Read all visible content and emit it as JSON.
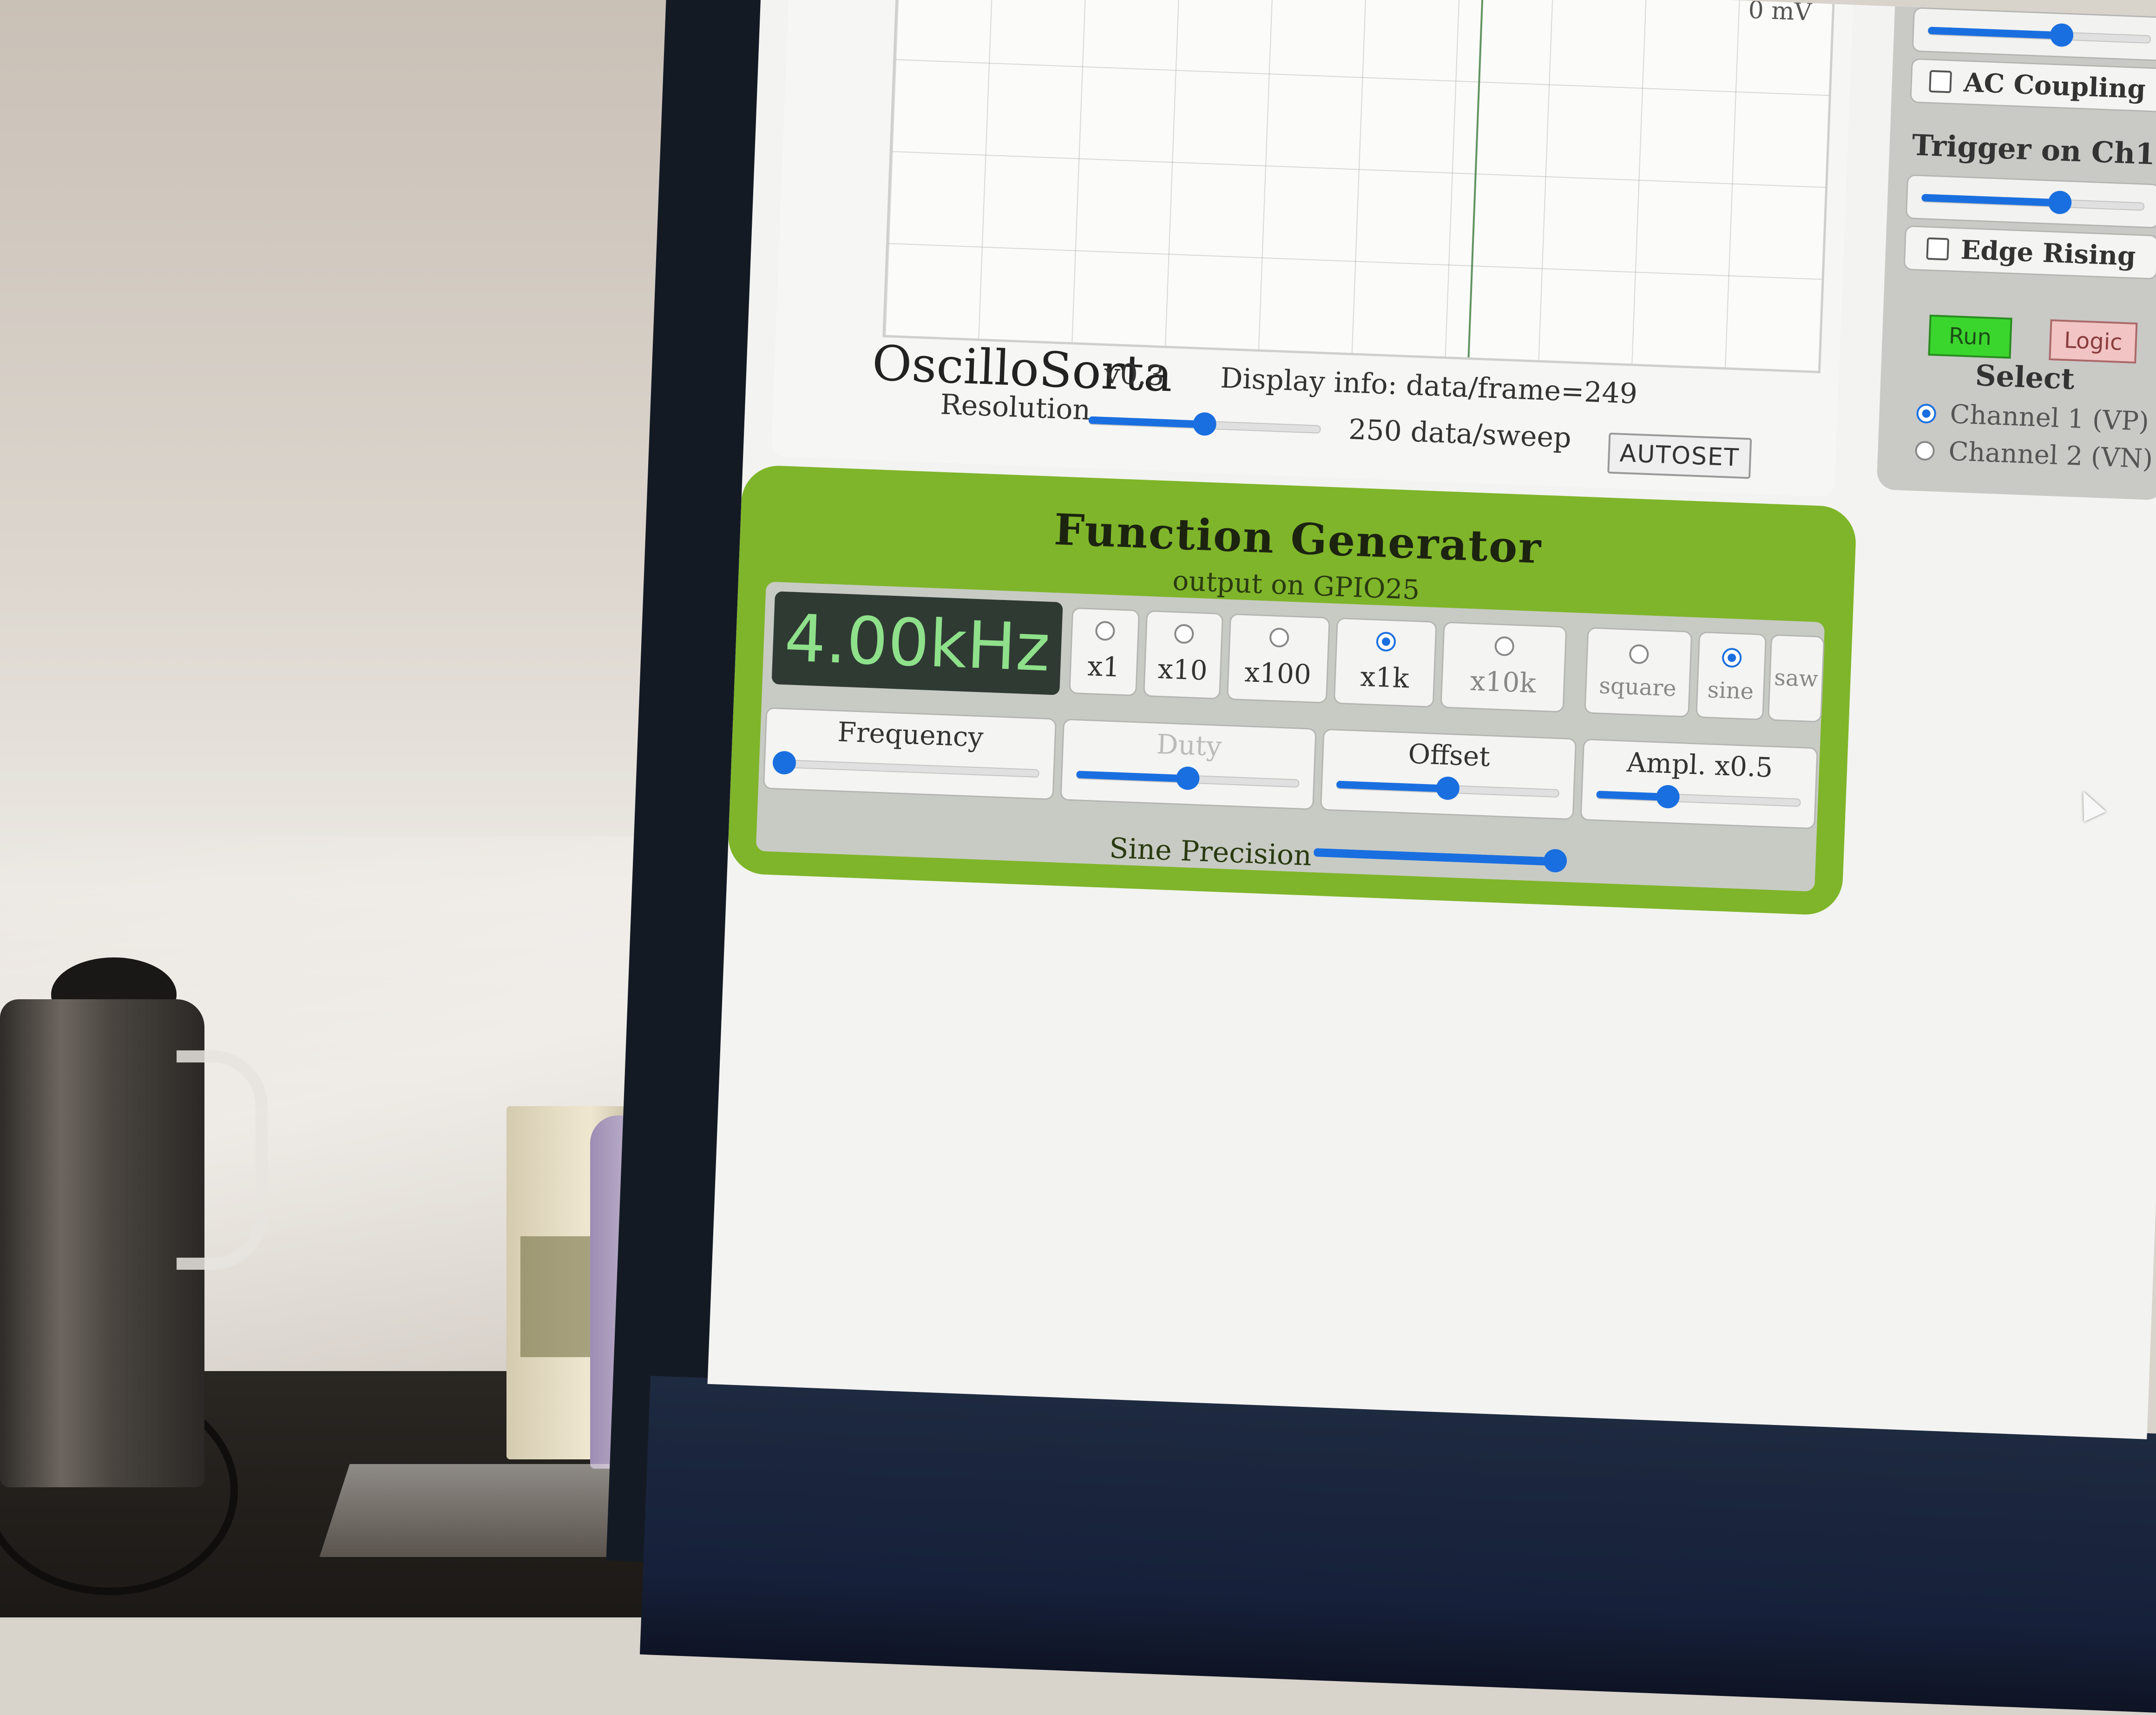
{
  "scope": {
    "plot_top_label": "0 mV",
    "app_title": "OscilloSorta",
    "app_version": "v0.3",
    "display_info": "Display info: data/frame=249",
    "resolution_label": "Resolution",
    "resolution_value": "250 data/sweep",
    "resolution_level": 0.5,
    "autoset_label": "AUTOSET"
  },
  "side": {
    "top_slider_level": 0.6,
    "ac_coupling_label": "AC Coupling",
    "trigger_heading": "Trigger on Ch1",
    "trigger_level": 0.62,
    "edge_label": "Edge Rising",
    "run_label": "Run",
    "logic_label": "Logic",
    "select_heading": "Select",
    "channels": [
      {
        "label": "Channel 1 (VP)",
        "selected": true
      },
      {
        "label": "Channel 2 (VN)",
        "selected": false
      }
    ]
  },
  "fg": {
    "title": "Function Generator",
    "subtitle": "output on GPIO25",
    "frequency_display": "4.00kHz",
    "multipliers": [
      {
        "label": "x1",
        "selected": false
      },
      {
        "label": "x10",
        "selected": false
      },
      {
        "label": "x100",
        "selected": false
      },
      {
        "label": "x1k",
        "selected": true
      },
      {
        "label": "x10k",
        "selected": false
      }
    ],
    "waveforms": [
      {
        "label": "square",
        "selected": false
      },
      {
        "label": "sine",
        "selected": true
      },
      {
        "label": "saw",
        "selected": false
      }
    ],
    "controls": [
      {
        "label": "Frequency",
        "level": 0.02,
        "disabled": false
      },
      {
        "label": "Duty",
        "level": 0.5,
        "disabled": true
      },
      {
        "label": "Offset",
        "level": 0.5,
        "disabled": false
      },
      {
        "label": "Ampl. x0.5",
        "level": 0.35,
        "disabled": false
      }
    ],
    "sine_precision_label": "Sine Precision",
    "sine_precision_level": 1.0
  },
  "colors": {
    "panel_green": "#7fb52a",
    "slider_blue": "#1a6fe0",
    "display_text": "#8fe08a",
    "run_green": "#3bd62d",
    "logic_pink": "#f2c4c4"
  }
}
